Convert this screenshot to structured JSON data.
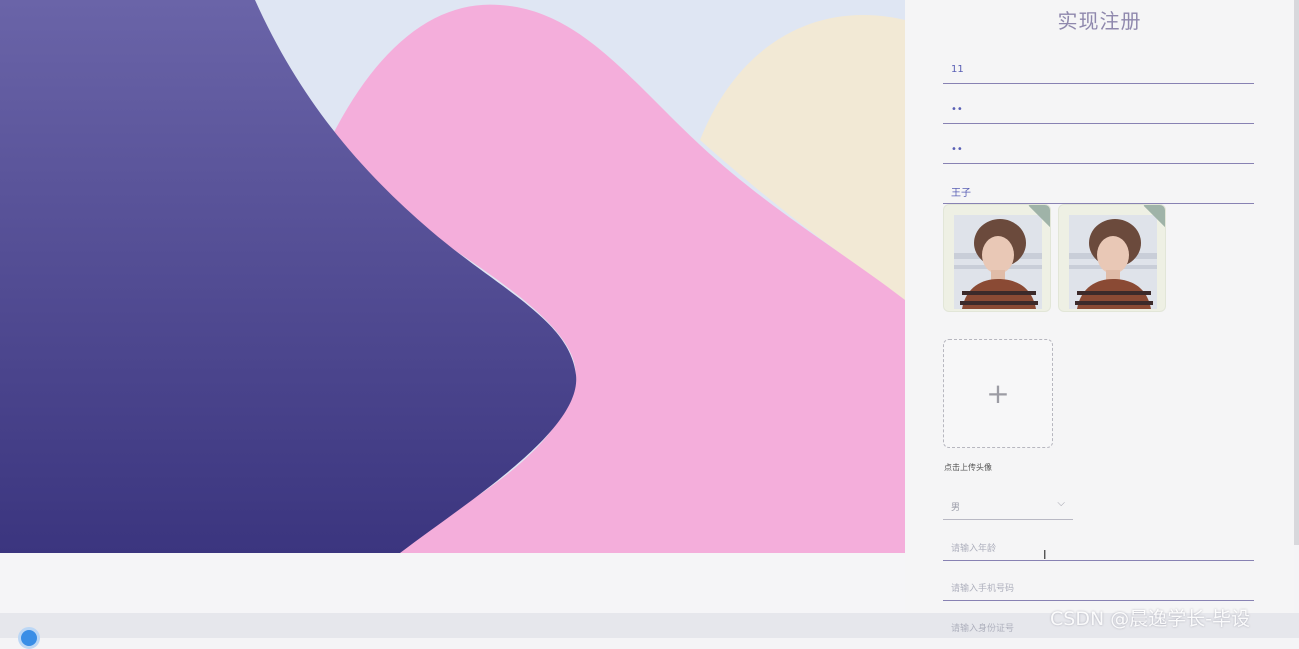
{
  "form": {
    "title": "实现注册",
    "fields": [
      {
        "value": "11"
      },
      {
        "value": "••"
      },
      {
        "value": "••"
      },
      {
        "value": "王子"
      }
    ],
    "avatar_thumbnails": 2,
    "upload_icon": "plus-icon",
    "upload_label": "点击上传头像",
    "gender_select": {
      "value": "男",
      "icon": "chevron-down-icon"
    },
    "age_placeholder": "请输入年龄",
    "phone_placeholder": "请输入手机号码",
    "id_placeholder": "请输入身份证号"
  },
  "watermark": "CSDN @晨逸学长-毕设",
  "colors": {
    "purple_shape": "#4f4a97",
    "pink_shape": "#f4aedb",
    "cream_shape": "#f2e9d5",
    "sky": "#dfe6f3",
    "accent": "#8882b3"
  }
}
